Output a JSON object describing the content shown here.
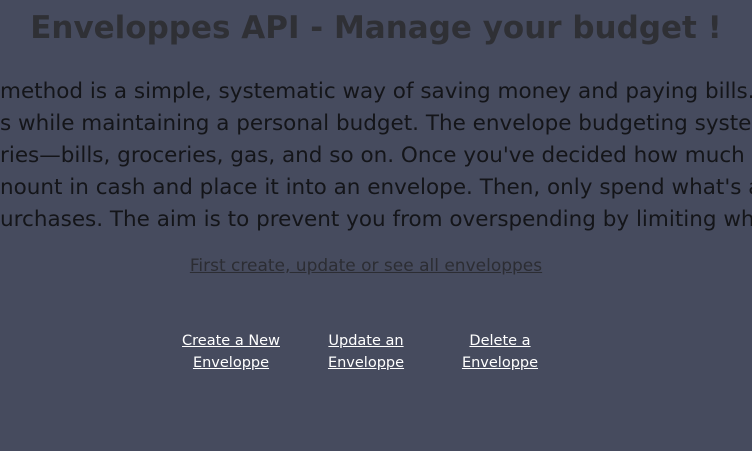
{
  "header": {
    "title": "Enveloppes API - Manage your budget !"
  },
  "intro": {
    "lines": [
      "method is a simple, systematic way of saving money and paying bills. Th",
      "s while maintaining a personal budget. The envelope budgeting system",
      "ries—bills, groceries, gas, and so on. Once you've decided how much yo",
      "nount in cash and place it into an envelope. Then, only spend what's ava",
      "urchases. The aim is to prevent you from overspending by limiting wha"
    ]
  },
  "links": {
    "section_link": "First create, update or see all enveloppes"
  },
  "actions": [
    {
      "label": "Create a New Enveloppe"
    },
    {
      "label": "Update an Enveloppe"
    },
    {
      "label": "Delete a Enveloppe"
    }
  ],
  "footer": {
    "partial_text": ""
  },
  "colors": {
    "background": "#464b5e",
    "title": "#2f3035",
    "body_text": "#141519",
    "action_links": "#ffffff"
  }
}
